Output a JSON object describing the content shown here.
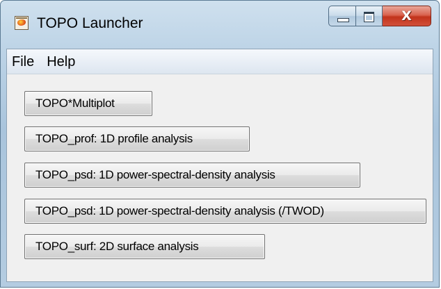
{
  "window": {
    "title": "TOPO Launcher",
    "app_icon": "topo-app-icon",
    "caption_buttons": {
      "minimize_icon": "minimize-icon",
      "maximize_icon": "maximize-icon",
      "close_icon": "close-icon",
      "close_glyph": "X"
    }
  },
  "menubar": {
    "items": [
      {
        "label": "File"
      },
      {
        "label": "Help"
      }
    ]
  },
  "buttons": [
    {
      "label": "TOPO*Multiplot"
    },
    {
      "label": "TOPO_prof: 1D profile analysis"
    },
    {
      "label": "TOPO_psd: 1D power-spectral-density analysis"
    },
    {
      "label": "TOPO_psd: 1D power-spectral-density analysis (/TWOD)"
    },
    {
      "label": "TOPO_surf: 2D surface analysis"
    }
  ],
  "colors": {
    "frame": "#a9c4dc",
    "close_button": "#c2331c",
    "client_background": "#f0f0f0"
  }
}
